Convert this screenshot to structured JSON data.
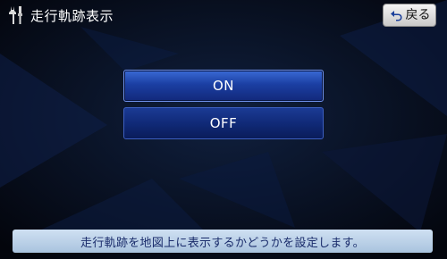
{
  "header": {
    "title": "走行軌跡表示",
    "settings_icon": "wrench-screwdriver-icon",
    "back_label": "戻る",
    "back_icon": "return-arrow-icon"
  },
  "options": {
    "on_label": "ON",
    "off_label": "OFF"
  },
  "help": {
    "text": "走行軌跡を地図上に表示するかどうかを設定します。"
  },
  "colors": {
    "background": "#05070f",
    "button_blue": "#1b3fa3",
    "help_bar": "#bcd2ea",
    "help_text": "#1a2c6b"
  }
}
